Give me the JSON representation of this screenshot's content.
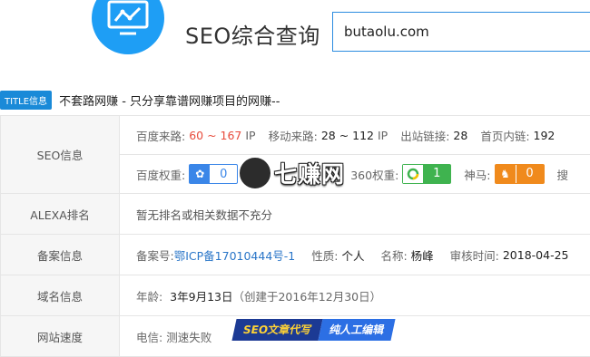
{
  "header": {
    "tool_title": "SEO综合查询",
    "domain_value": "butaolu.com"
  },
  "title_row": {
    "badge": "TITLE信息",
    "text": "不套路网赚 - 只分享靠谱网赚项目的网赚--"
  },
  "seo": {
    "label": "SEO信息",
    "baidu_traffic": {
      "label": "百度来路:",
      "value": "60 ~ 167",
      "unit": "IP"
    },
    "mobile_traffic": {
      "label": "移动来路:",
      "value": "28 ~ 112",
      "unit": "IP"
    },
    "outbound_links": {
      "label": "出站链接:",
      "value": "28"
    },
    "home_inner_links": {
      "label": "首页内链:",
      "value": "192"
    },
    "baidu_weight": {
      "label": "百度权重:",
      "value": "0",
      "icon": "paw-icon"
    },
    "weight_360": {
      "label": "360权重:",
      "value": "1",
      "icon": "360-icon"
    },
    "shenma": {
      "label": "神马:",
      "value": "0",
      "icon": "horse-icon"
    },
    "sogou_label": "搜"
  },
  "watermark": {
    "text": "七赚网"
  },
  "alexa": {
    "label": "ALEXA排名",
    "text": "暂无排名或相关数据不充分"
  },
  "icp": {
    "label": "备案信息",
    "number_label": "备案号:",
    "number": "鄂ICP备17010444号-1",
    "nature_label": "性质:",
    "nature": "个人",
    "name_label": "名称:",
    "name": "杨峰",
    "audit_label": "审核时间:",
    "audit": "2018-04-25"
  },
  "domain_info": {
    "label": "域名信息",
    "age_label": "年龄:",
    "age": "3年9月13日",
    "created": "（创建于2016年12月30日）"
  },
  "speed": {
    "label": "网站速度",
    "telecom_label": "电信:",
    "telecom": "测速失败"
  },
  "banner": {
    "part1": "SEO文章代写",
    "part2": "纯人工编辑"
  },
  "colors": {
    "accent": "#1e9ef5",
    "red": "#e84c3d",
    "link": "#2a76c8"
  }
}
